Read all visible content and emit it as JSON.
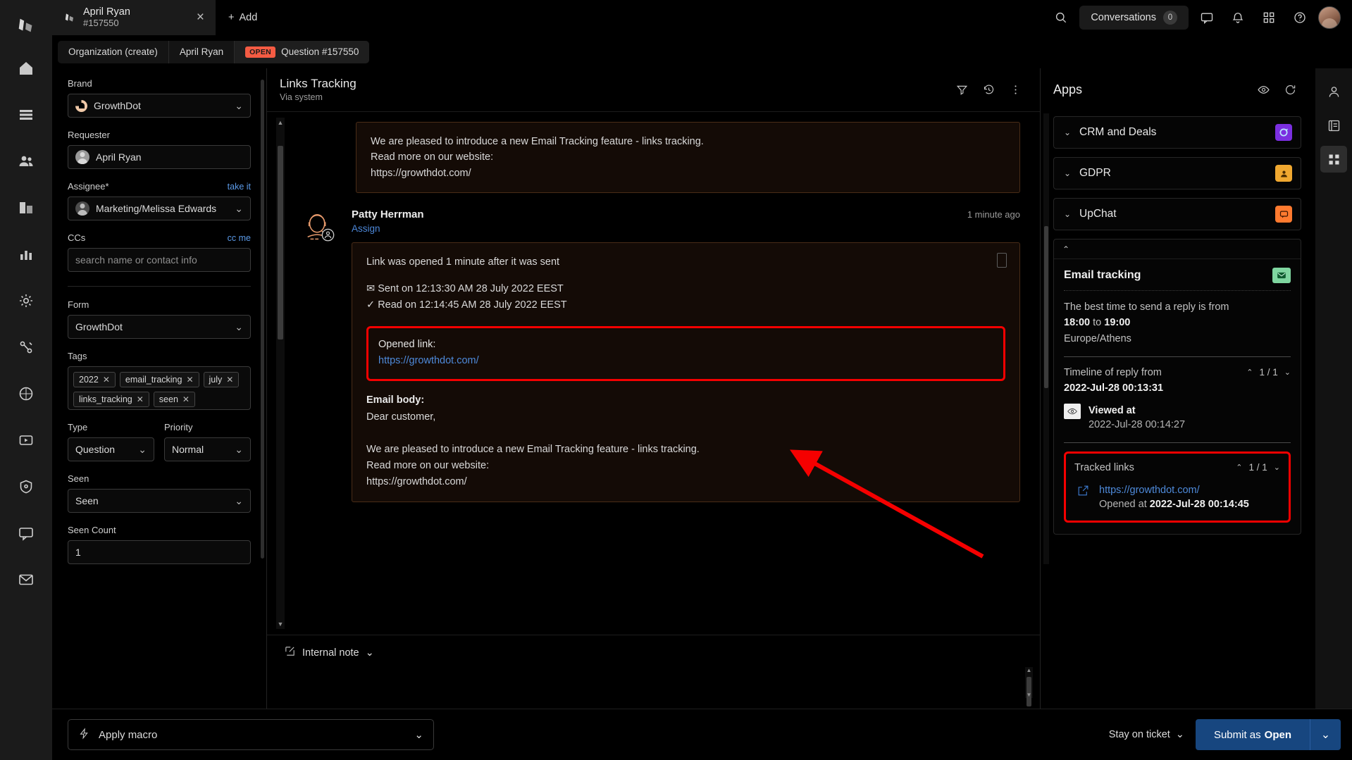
{
  "window": {
    "tab": {
      "title": "April Ryan",
      "subtitle": "#157550",
      "close": "×"
    },
    "add_tab": "Add",
    "conversations_label": "Conversations",
    "conversations_count": "0"
  },
  "breadcrumb": {
    "items": [
      {
        "label": "Organization (create)",
        "badge": ""
      },
      {
        "label": "April Ryan",
        "badge": ""
      },
      {
        "label": "Question #157550",
        "badge": "OPEN"
      }
    ]
  },
  "properties": {
    "brand": {
      "label": "Brand",
      "value": "GrowthDot"
    },
    "requester": {
      "label": "Requester",
      "value": "April Ryan"
    },
    "assignee": {
      "label": "Assignee*",
      "action": "take it",
      "value": "Marketing/Melissa Edwards"
    },
    "ccs": {
      "label": "CCs",
      "action": "cc me",
      "placeholder": "search name or contact info"
    },
    "form": {
      "label": "Form",
      "value": "GrowthDot"
    },
    "tags": {
      "label": "Tags",
      "items": [
        "2022",
        "email_tracking",
        "july",
        "links_tracking",
        "seen"
      ]
    },
    "type": {
      "label": "Type",
      "value": "Question"
    },
    "priority": {
      "label": "Priority",
      "value": "Normal"
    },
    "seen": {
      "label": "Seen",
      "value": "Seen"
    },
    "seen_count": {
      "label": "Seen Count",
      "value": "1"
    }
  },
  "conversation": {
    "title": "Links Tracking",
    "subtitle": "Via system",
    "top_message": "We are pleased to introduce a new Email Tracking feature - links tracking.\nRead more on our website:\nhttps://growthdot.com/",
    "entry": {
      "author": "Patty Herrman",
      "assign_label": "Assign",
      "time": "1 minute ago",
      "headline": "Link was opened 1 minute after it was sent",
      "sent_line": "Sent on 12:13:30 AM 28 July 2022 EEST",
      "read_line": "Read on 12:14:45 AM 28 July 2022 EEST",
      "opened_link_label": "Opened link:",
      "opened_link_url": "https://growthdot.com/",
      "email_body_label": "Email body:",
      "email_body": "Dear customer,\n\nWe are pleased to introduce a new Email Tracking feature - links tracking.\nRead more on our website:\nhttps://growthdot.com/"
    }
  },
  "composer": {
    "mode": "Internal note"
  },
  "apps": {
    "title": "Apps",
    "cards": [
      {
        "name": "CRM and Deals"
      },
      {
        "name": "GDPR"
      },
      {
        "name": "UpChat"
      }
    ],
    "email_tracking": {
      "title": "Email tracking",
      "best_time_prefix": "The best time to send a reply is from",
      "best_time_from": "18:00",
      "best_time_to_word": "to",
      "best_time_to": "19:00",
      "timezone": "Europe/Athens",
      "timeline_label": "Timeline of reply from",
      "timeline_value": "2022-Jul-28 00:13:31",
      "timeline_pager": "1 / 1",
      "viewed_label": "Viewed at",
      "viewed_value": "2022-Jul-28 00:14:27",
      "tracked_links_label": "Tracked links",
      "tracked_links_pager": "1 / 1",
      "tracked_link_url": "https://growthdot.com/",
      "tracked_link_opened_prefix": "Opened at",
      "tracked_link_opened_value": "2022-Jul-28 00:14:45"
    }
  },
  "footer": {
    "macro": "Apply macro",
    "stay": "Stay on ticket",
    "submit_prefix": "Submit as",
    "submit_state": "Open"
  },
  "colors": {
    "accent_open": "#f45b43",
    "link": "#4e8ada",
    "highlight": "#f50000",
    "submit": "#17467f"
  }
}
